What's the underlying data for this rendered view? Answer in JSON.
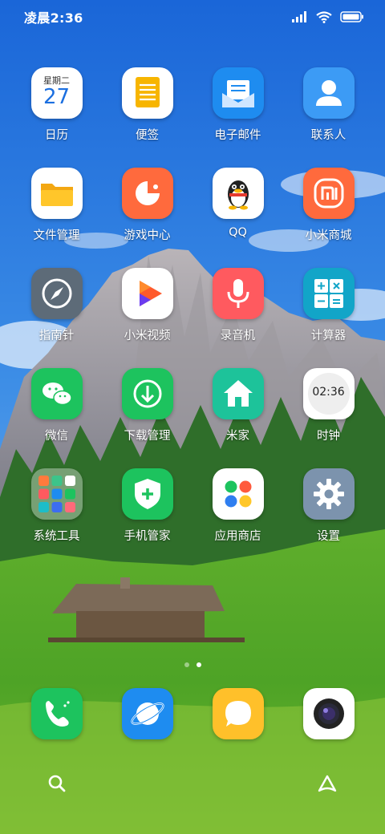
{
  "status_bar": {
    "time": "凌晨2:36",
    "icons": [
      "signal-icon",
      "wifi-icon",
      "battery-icon"
    ]
  },
  "calendar_widget": {
    "weekday": "星期二",
    "day": "27"
  },
  "clock_widget": {
    "time": "02:36"
  },
  "apps": [
    {
      "label": "日历",
      "icon": "calendar-icon"
    },
    {
      "label": "便签",
      "icon": "notes-icon"
    },
    {
      "label": "电子邮件",
      "icon": "email-icon"
    },
    {
      "label": "联系人",
      "icon": "contacts-icon"
    },
    {
      "label": "文件管理",
      "icon": "folder-icon"
    },
    {
      "label": "游戏中心",
      "icon": "game-center-icon"
    },
    {
      "label": "QQ",
      "icon": "qq-penguin-icon"
    },
    {
      "label": "小米商城",
      "icon": "mi-store-icon"
    },
    {
      "label": "指南针",
      "icon": "compass-icon"
    },
    {
      "label": "小米视频",
      "icon": "video-play-icon"
    },
    {
      "label": "录音机",
      "icon": "microphone-icon"
    },
    {
      "label": "计算器",
      "icon": "calculator-icon"
    },
    {
      "label": "微信",
      "icon": "wechat-icon"
    },
    {
      "label": "下载管理",
      "icon": "download-icon"
    },
    {
      "label": "米家",
      "icon": "home-icon"
    },
    {
      "label": "时钟",
      "icon": "clock-icon"
    },
    {
      "label": "系统工具",
      "icon": "folder-group-icon"
    },
    {
      "label": "手机管家",
      "icon": "shield-icon"
    },
    {
      "label": "应用商店",
      "icon": "app-store-icon"
    },
    {
      "label": "设置",
      "icon": "gear-icon"
    }
  ],
  "page_indicator": {
    "pages": 2,
    "active": 2
  },
  "dock": [
    {
      "icon": "phone-icon"
    },
    {
      "icon": "browser-icon"
    },
    {
      "icon": "messages-icon"
    },
    {
      "icon": "camera-icon"
    }
  ],
  "bottom_bar": {
    "left": "search-icon",
    "right": "app-vault-icon"
  }
}
